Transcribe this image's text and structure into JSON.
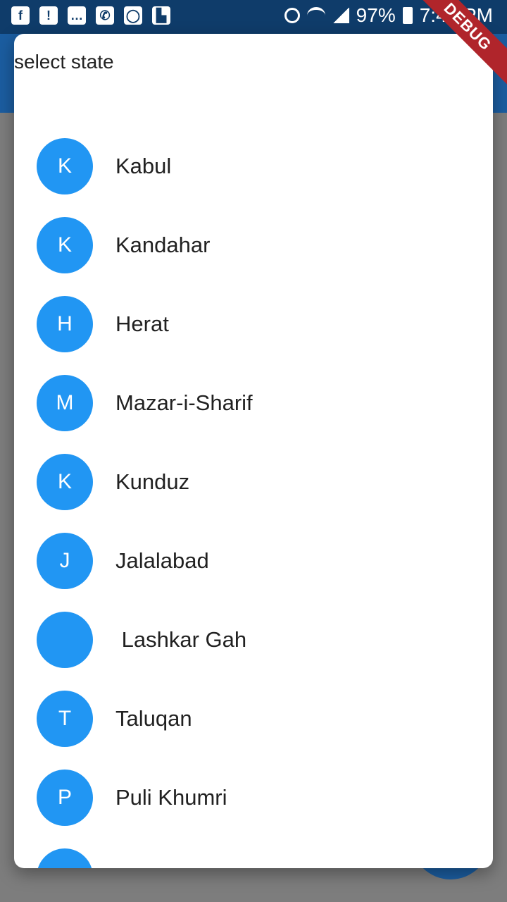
{
  "status_bar": {
    "battery": "97%",
    "time": "7:44 PM",
    "icons": [
      "facebook-icon",
      "warning-icon",
      "message-icon",
      "missed-call-icon",
      "whatsapp-icon",
      "flipboard-icon",
      "alarm-icon",
      "wifi-icon",
      "signal-icon",
      "battery-icon"
    ]
  },
  "dialog": {
    "title": "select state",
    "items": [
      {
        "initial": "K",
        "label": "Kabul"
      },
      {
        "initial": "K",
        "label": "Kandahar"
      },
      {
        "initial": "H",
        "label": "Herat"
      },
      {
        "initial": "M",
        "label": "Mazar-i-Sharif"
      },
      {
        "initial": "K",
        "label": "Kunduz"
      },
      {
        "initial": "J",
        "label": "Jalalabad"
      },
      {
        "initial": "",
        "label": " Lashkar Gah"
      },
      {
        "initial": "T",
        "label": "Taluqan"
      },
      {
        "initial": "P",
        "label": "Puli Khumri"
      },
      {
        "initial": "",
        "label": ""
      }
    ]
  },
  "banner": {
    "label": "DEBUG"
  },
  "colors": {
    "accent": "#2196f3",
    "app_bar": "#1b5da0",
    "status_bar": "#0f3c6a",
    "banner": "#b0252b"
  }
}
